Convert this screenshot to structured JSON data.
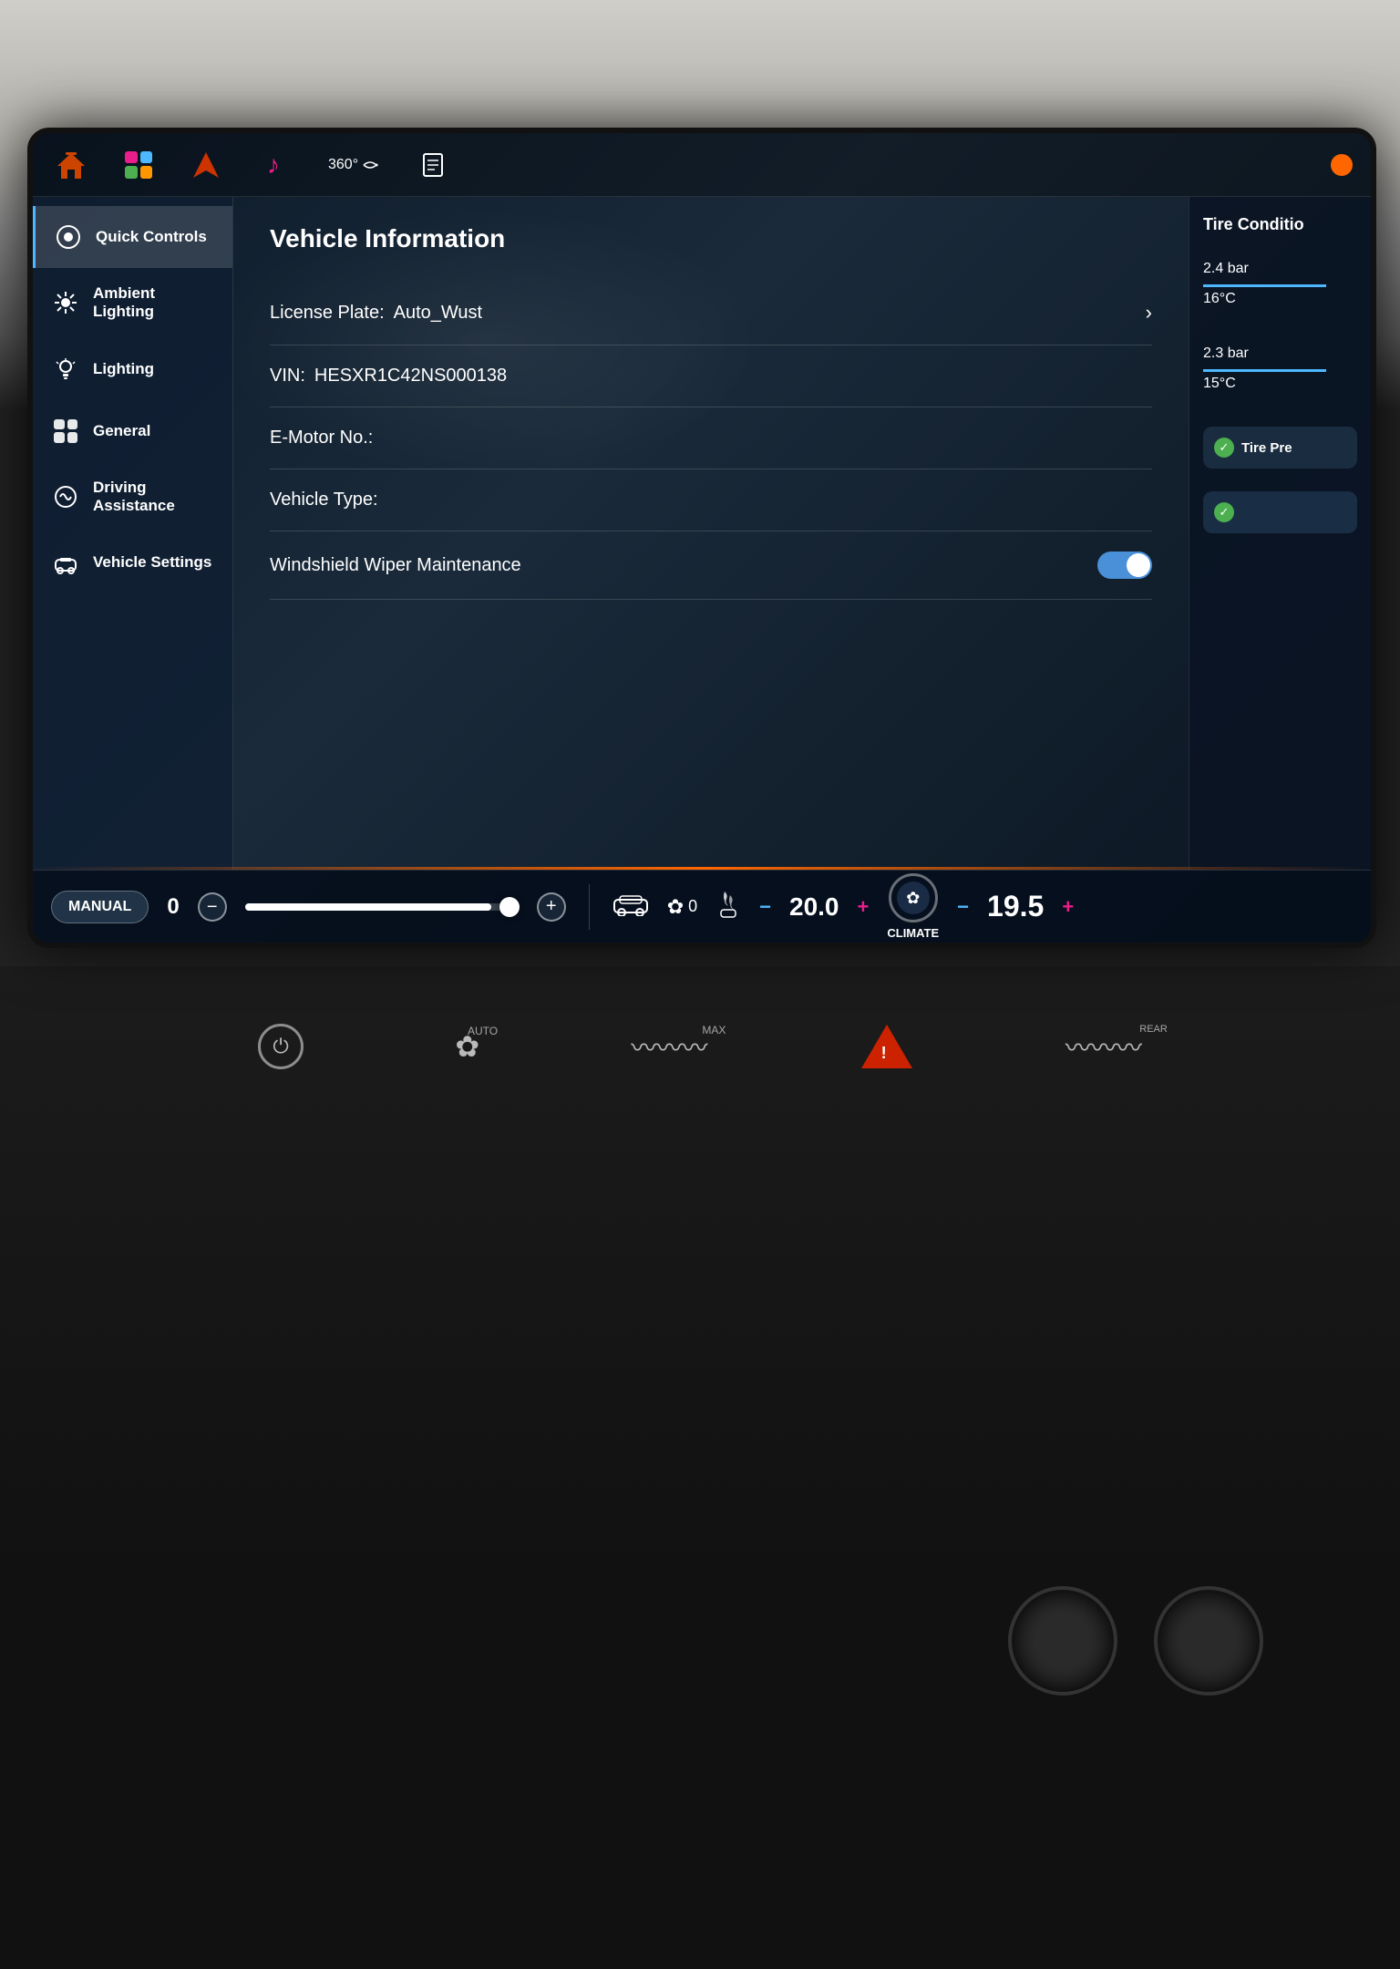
{
  "nav": {
    "icons": [
      "home",
      "grid",
      "navigate",
      "music",
      "360",
      "document"
    ],
    "notification": true
  },
  "sidebar": {
    "items": [
      {
        "id": "quick-controls",
        "label": "Quick Controls",
        "icon": "⊙",
        "active": true
      },
      {
        "id": "ambient-lighting",
        "label": "Ambient Lighting",
        "icon": "✦",
        "active": false
      },
      {
        "id": "lighting",
        "label": "Lighting",
        "icon": "✳",
        "active": false
      },
      {
        "id": "general",
        "label": "General",
        "icon": "⊞",
        "active": false
      },
      {
        "id": "driving-assistance",
        "label": "Driving Assistance",
        "icon": "⟳",
        "active": false
      },
      {
        "id": "vehicle-settings",
        "label": "Vehicle Settings",
        "icon": "🚗",
        "active": false
      }
    ]
  },
  "vehicle_info": {
    "title": "Vehicle Information",
    "fields": [
      {
        "label": "License Plate:",
        "value": "Auto_Wust",
        "has_chevron": true
      },
      {
        "label": "VIN:",
        "value": "HESXR1C42NS000138",
        "has_chevron": false
      },
      {
        "label": "E-Motor No.:",
        "value": "",
        "has_chevron": false
      },
      {
        "label": "Vehicle Type:",
        "value": "",
        "has_chevron": false
      },
      {
        "label": "Windshield Wiper Maintenance",
        "value": "",
        "has_toggle": true
      }
    ]
  },
  "tire_condition": {
    "title": "Tire Conditio",
    "readings": [
      {
        "bar": "2.4 bar",
        "temp": "16°C"
      },
      {
        "bar": "2.3 bar",
        "temp": "15°C"
      }
    ],
    "tire_pre_label": "Tire Pre",
    "check_label": "Tire Pre"
  },
  "bottom_bar": {
    "manual_label": "MANUAL",
    "speed_value": "0",
    "slider_percent": 90,
    "temp_left_value": "20.0",
    "temp_left_minus": "−",
    "temp_left_plus": "+",
    "climate_label": "CLIMATE",
    "temp_right_value": "19.5",
    "temp_right_minus": "−",
    "temp_right_plus": "+",
    "fan_value": "✿0"
  },
  "physical_controls": {
    "fan_auto_label": "AUTO",
    "fan_max_label": "MAX",
    "rear_label": "REAR",
    "power_icon": "⏻",
    "hazard_visible": true
  }
}
